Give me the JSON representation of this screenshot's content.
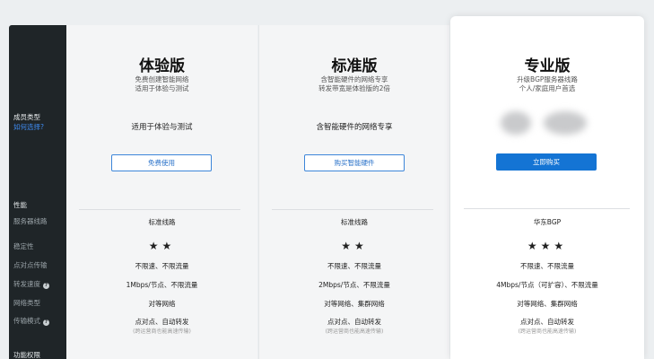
{
  "sidebar": {
    "member_type_label": "成员类型",
    "how_to_choose": "如何选择?",
    "performance_heading": "性能",
    "items": [
      {
        "label": "服务器线路",
        "help": false
      },
      {
        "label": "稳定性",
        "help": false
      },
      {
        "label": "点对点传输",
        "help": false
      },
      {
        "label": "转发速度",
        "help": true
      },
      {
        "label": "网络类型",
        "help": false
      },
      {
        "label": "传输模式",
        "help": true
      }
    ],
    "features_heading": "功能权限",
    "help_glyph": "?"
  },
  "plans": [
    {
      "title": "体验版",
      "subtitle_1": "免费创建智能网络",
      "subtitle_2": "适用于体验与测试",
      "suitable": "适用于体验与测试",
      "button": "免费使用",
      "line": "标准线路",
      "stability_stars": 2,
      "p2p": "不限速、不限流量",
      "forward": "1Mbps/节点、不限流量",
      "network": "对等网络",
      "mode": "点对点、自动转发",
      "mode_note": "(跨运营商也能高速传输)"
    },
    {
      "title": "标准版",
      "subtitle_1": "含智能硬件的网络专享",
      "subtitle_2": "转发带宽是体验版的2倍",
      "suitable": "含智能硬件的网络专享",
      "button": "购买智能硬件",
      "line": "标准线路",
      "stability_stars": 2,
      "p2p": "不限速、不限流量",
      "forward": "2Mbps/节点、不限流量",
      "network": "对等网络、集群网络",
      "mode": "点对点、自动转发",
      "mode_note": "(跨运营商也能高速传输)"
    },
    {
      "title": "专业版",
      "subtitle_1": "升级BGP服务器线路",
      "subtitle_2": "个人/家庭用户首选",
      "button": "立即购买",
      "line": "华东BGP",
      "stability_stars": 3,
      "p2p": "不限速、不限流量",
      "forward": "4Mbps/节点（可扩容）、不限流量",
      "network": "对等网络、集群网络",
      "mode": "点对点、自动转发",
      "mode_note": "(跨运营商也能高速传输)"
    }
  ],
  "star_glyph": "★",
  "colors": {
    "sidebar_bg": "#1f2528",
    "accent": "#1474d4",
    "link": "#3f8bf0"
  }
}
